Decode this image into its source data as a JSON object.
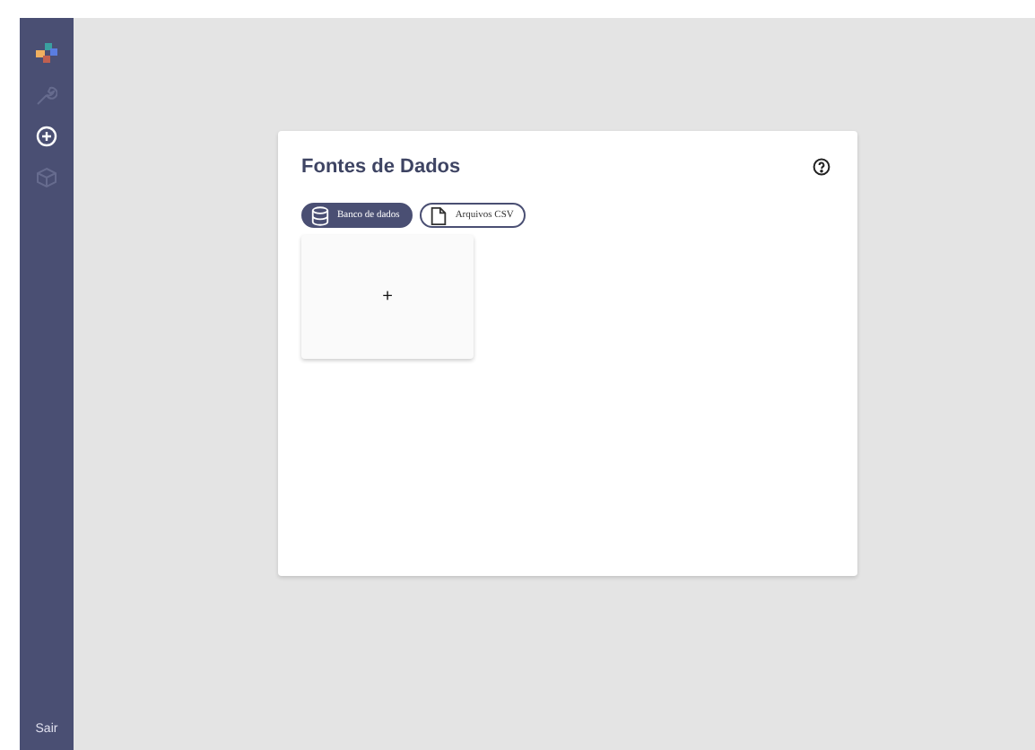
{
  "sidebar": {
    "items": [
      {
        "kind": "logo",
        "disabled": false
      },
      {
        "kind": "wrench",
        "disabled": true
      },
      {
        "kind": "plus",
        "disabled": false
      },
      {
        "kind": "cube",
        "disabled": true
      }
    ],
    "logout": "Sair"
  },
  "panel": {
    "title": "Fontes de Dados",
    "tabs": [
      {
        "label": "Banco de dados",
        "kind": "database",
        "selected": true
      },
      {
        "label": "Arquivos CSV",
        "kind": "file",
        "selected": false
      }
    ],
    "add_card": "+"
  }
}
